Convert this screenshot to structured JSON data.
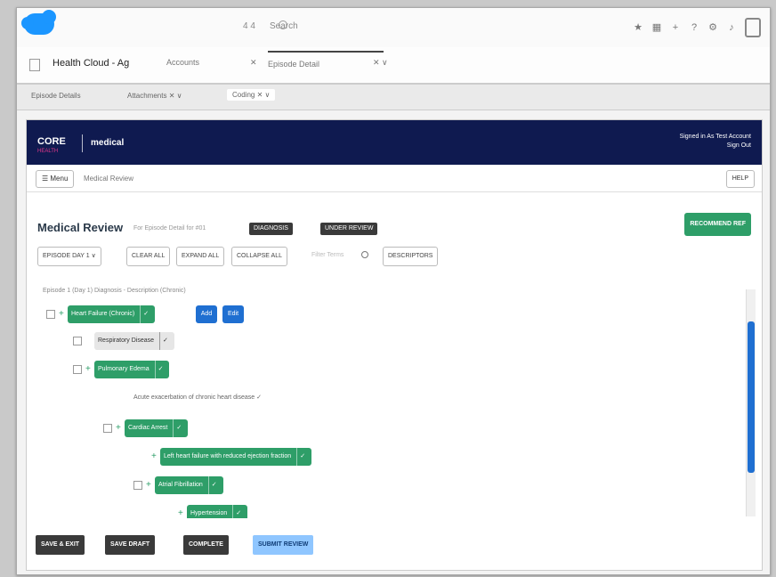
{
  "global_header": {
    "search_label": "4 4",
    "search_text": "Search",
    "util_icons": [
      "avatar-icon",
      "grid-icon",
      "bell-icon",
      "help-icon",
      "gear-icon",
      "settings-icon",
      "profile-icon"
    ]
  },
  "tabbar": {
    "app_name": "Health Cloud - Ag",
    "tabs": [
      {
        "label": "Accounts",
        "active": false
      },
      {
        "label": "✕",
        "active": false
      },
      {
        "label": "Episode Detail",
        "active": true
      },
      {
        "label": "✕ ∨",
        "active": false
      }
    ]
  },
  "subtabs": [
    {
      "label": "Episode Details",
      "active": false
    },
    {
      "label": "Attachments  ✕ ∨",
      "active": false
    },
    {
      "label": "Coding  ✕ ∨",
      "active": true
    }
  ],
  "banner": {
    "brand": "CORE",
    "brand_sub": "HEALTH",
    "brand2": "medical",
    "user_line1": "Signed in As Test Account",
    "user_line2": "Sign Out"
  },
  "toolbar": {
    "menu_label": "☰ Menu",
    "breadcrumb": "Medical Review",
    "help_label": "HELP"
  },
  "title": {
    "text": "Medical Review",
    "subtitle": "For Episode Detail for #01",
    "tag1": "DIAGNOSIS",
    "tag2": "UNDER REVIEW",
    "approve_label": "RECOMMEND REF"
  },
  "controls": {
    "episode_select": "EPISODE DAY 1 ∨",
    "clear_all": "CLEAR ALL",
    "expand_all": "EXPAND ALL",
    "collapse_all": "COLLAPSE ALL",
    "search_placeholder": "Filter Terms",
    "descriptors": "DESCRIPTORS"
  },
  "tree": {
    "header": "Episode 1 (Day 1) Diagnosis - Description (Chronic)",
    "nodes": [
      {
        "label": "Heart Failure (Chronic)",
        "x": "✓",
        "kind": "green"
      },
      {
        "label": "Respiratory Disease",
        "x": "✓",
        "kind": "gray"
      },
      {
        "label": "Pulmonary Edema",
        "x": "✓",
        "kind": "green"
      },
      {
        "label": "Acute exacerbation of chronic heart disease",
        "x": "✓",
        "kind": "text"
      },
      {
        "label": "Cardiac Arrest",
        "x": "✓",
        "kind": "green"
      },
      {
        "label": "Left heart failure with reduced ejection fraction",
        "x": "✓",
        "kind": "green"
      },
      {
        "label": "Atrial Fibrillation",
        "x": "✓",
        "kind": "green"
      },
      {
        "label": "Hypertension",
        "x": "✓",
        "kind": "green"
      }
    ],
    "blue_tags": [
      "Add",
      "Edit"
    ]
  },
  "footer": {
    "buttons": [
      "SAVE & EXIT",
      "SAVE DRAFT",
      "COMPLETE",
      "SUBMIT REVIEW"
    ]
  },
  "colors": {
    "banner": "#0f1a50",
    "green": "#2e9e68",
    "blue": "#1f6fd1",
    "brand_accent": "#1b96ff"
  }
}
